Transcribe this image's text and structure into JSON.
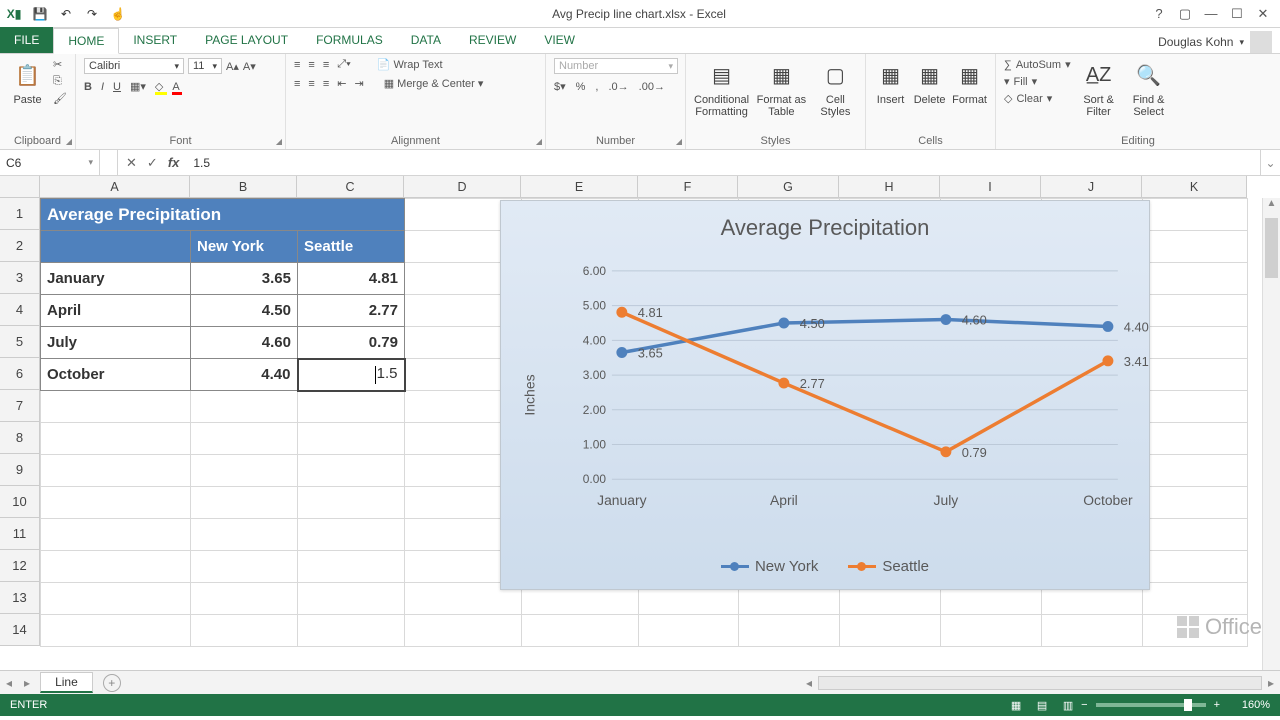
{
  "app": {
    "title": "Avg Precip line chart.xlsx - Excel",
    "user": "Douglas Kohn"
  },
  "qat": {
    "excel": "X▮",
    "save": "💾",
    "undo": "↶",
    "redo": "↷",
    "touch": "☝"
  },
  "tabs": {
    "file": "FILE",
    "home": "HOME",
    "insert": "INSERT",
    "pagelayout": "PAGE LAYOUT",
    "formulas": "FORMULAS",
    "data": "DATA",
    "review": "REVIEW",
    "view": "VIEW"
  },
  "ribbon": {
    "clipboard": {
      "paste": "Paste",
      "label": "Clipboard",
      "cut": "✂",
      "copy": "⎘",
      "fmtpaint": "🖌"
    },
    "font": {
      "name": "Calibri",
      "size": "11",
      "label": "Font",
      "bold": "B",
      "italic": "I",
      "underline": "U"
    },
    "alignment": {
      "wrap": "Wrap Text",
      "merge": "Merge & Center",
      "label": "Alignment"
    },
    "number": {
      "format": "Number",
      "label": "Number"
    },
    "styles": {
      "cond": "Conditional Formatting",
      "fat": "Format as Table",
      "cs": "Cell Styles",
      "label": "Styles"
    },
    "cells": {
      "ins": "Insert",
      "del": "Delete",
      "fmt": "Format",
      "label": "Cells"
    },
    "editing": {
      "sum": "AutoSum",
      "fill": "Fill",
      "clear": "Clear",
      "sort": "Sort & Filter",
      "find": "Find & Select",
      "label": "Editing"
    }
  },
  "namebox": {
    "ref": "C6"
  },
  "formula": {
    "value": "1.5"
  },
  "columns": [
    "A",
    "B",
    "C",
    "D",
    "E",
    "F",
    "G",
    "H",
    "I",
    "J",
    "K"
  ],
  "rows": [
    "1",
    "2",
    "3",
    "4",
    "5",
    "6",
    "7",
    "8",
    "9",
    "10",
    "11",
    "12",
    "13",
    "14"
  ],
  "table": {
    "title": "Average Precipitation",
    "headers": {
      "b": "New York",
      "c": "Seattle"
    },
    "rows": [
      {
        "a": "January",
        "b": "3.65",
        "c": "4.81"
      },
      {
        "a": "April",
        "b": "4.50",
        "c": "2.77"
      },
      {
        "a": "July",
        "b": "4.60",
        "c": "0.79"
      },
      {
        "a": "October",
        "b": "4.40",
        "c": "1.5"
      }
    ]
  },
  "chart_data": {
    "type": "line",
    "title": "Average Precipitation",
    "ylabel": "Inches",
    "categories": [
      "January",
      "April",
      "July",
      "October"
    ],
    "ylim": [
      0,
      6
    ],
    "yticks": [
      "0.00",
      "1.00",
      "2.00",
      "3.00",
      "4.00",
      "5.00",
      "6.00"
    ],
    "series": [
      {
        "name": "New York",
        "color": "#4f81bd",
        "values": [
          3.65,
          4.5,
          4.6,
          4.4
        ],
        "labels": [
          "3.65",
          "4.50",
          "4.60",
          "4.40"
        ]
      },
      {
        "name": "Seattle",
        "color": "#ed7d31",
        "values": [
          4.81,
          2.77,
          0.79,
          3.41
        ],
        "labels": [
          "4.81",
          "2.77",
          "0.79",
          "3.41"
        ]
      }
    ]
  },
  "sheets": {
    "active": "Line"
  },
  "status": {
    "mode": "ENTER",
    "zoom": "160%"
  },
  "office_brand": "Office"
}
